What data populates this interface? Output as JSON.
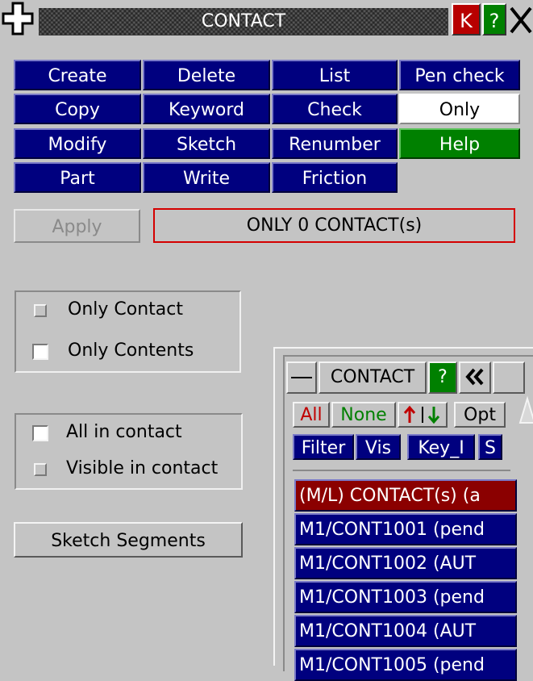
{
  "window": {
    "title": "CONTACT",
    "k_label": "K",
    "help_label": "?"
  },
  "grid": [
    [
      "Create",
      "Delete",
      "List",
      "Pen check"
    ],
    [
      "Copy",
      "Keyword",
      "Check",
      "Only"
    ],
    [
      "Modify",
      "Sketch",
      "Renumber",
      "Help"
    ],
    [
      "Part",
      "Write",
      "Friction"
    ]
  ],
  "apply_label": "Apply",
  "status_text": "ONLY 0 CONTACT(s)",
  "only_group": {
    "only_contact": "Only Contact",
    "only_contents": "Only Contents"
  },
  "contact_group": {
    "all_in_contact": "All in contact",
    "visible_in_contact": "Visible in contact"
  },
  "sketch_segments_label": "Sketch Segments",
  "subwindow": {
    "title": "CONTACT",
    "help_label": "?",
    "all_label": "All",
    "none_label": "None",
    "opt_label": "Opt",
    "filter_label": "Filter",
    "vis_label": "Vis",
    "key_label": "Key_I",
    "s_label": "S",
    "rows": [
      "(M/L) CONTACT(s) (a",
      "M1/CONT1001  (pend",
      "M1/CONT1002  (AUT",
      "M1/CONT1003  (pend",
      "M1/CONT1004  (AUT",
      "M1/CONT1005  (pend"
    ]
  },
  "colors": {
    "panel_bg": "#c4c4c4",
    "button_blue": "#00007f",
    "button_green": "#008000",
    "button_red": "#b80000",
    "header_row_red": "#8b0000",
    "status_border": "#d40000"
  }
}
